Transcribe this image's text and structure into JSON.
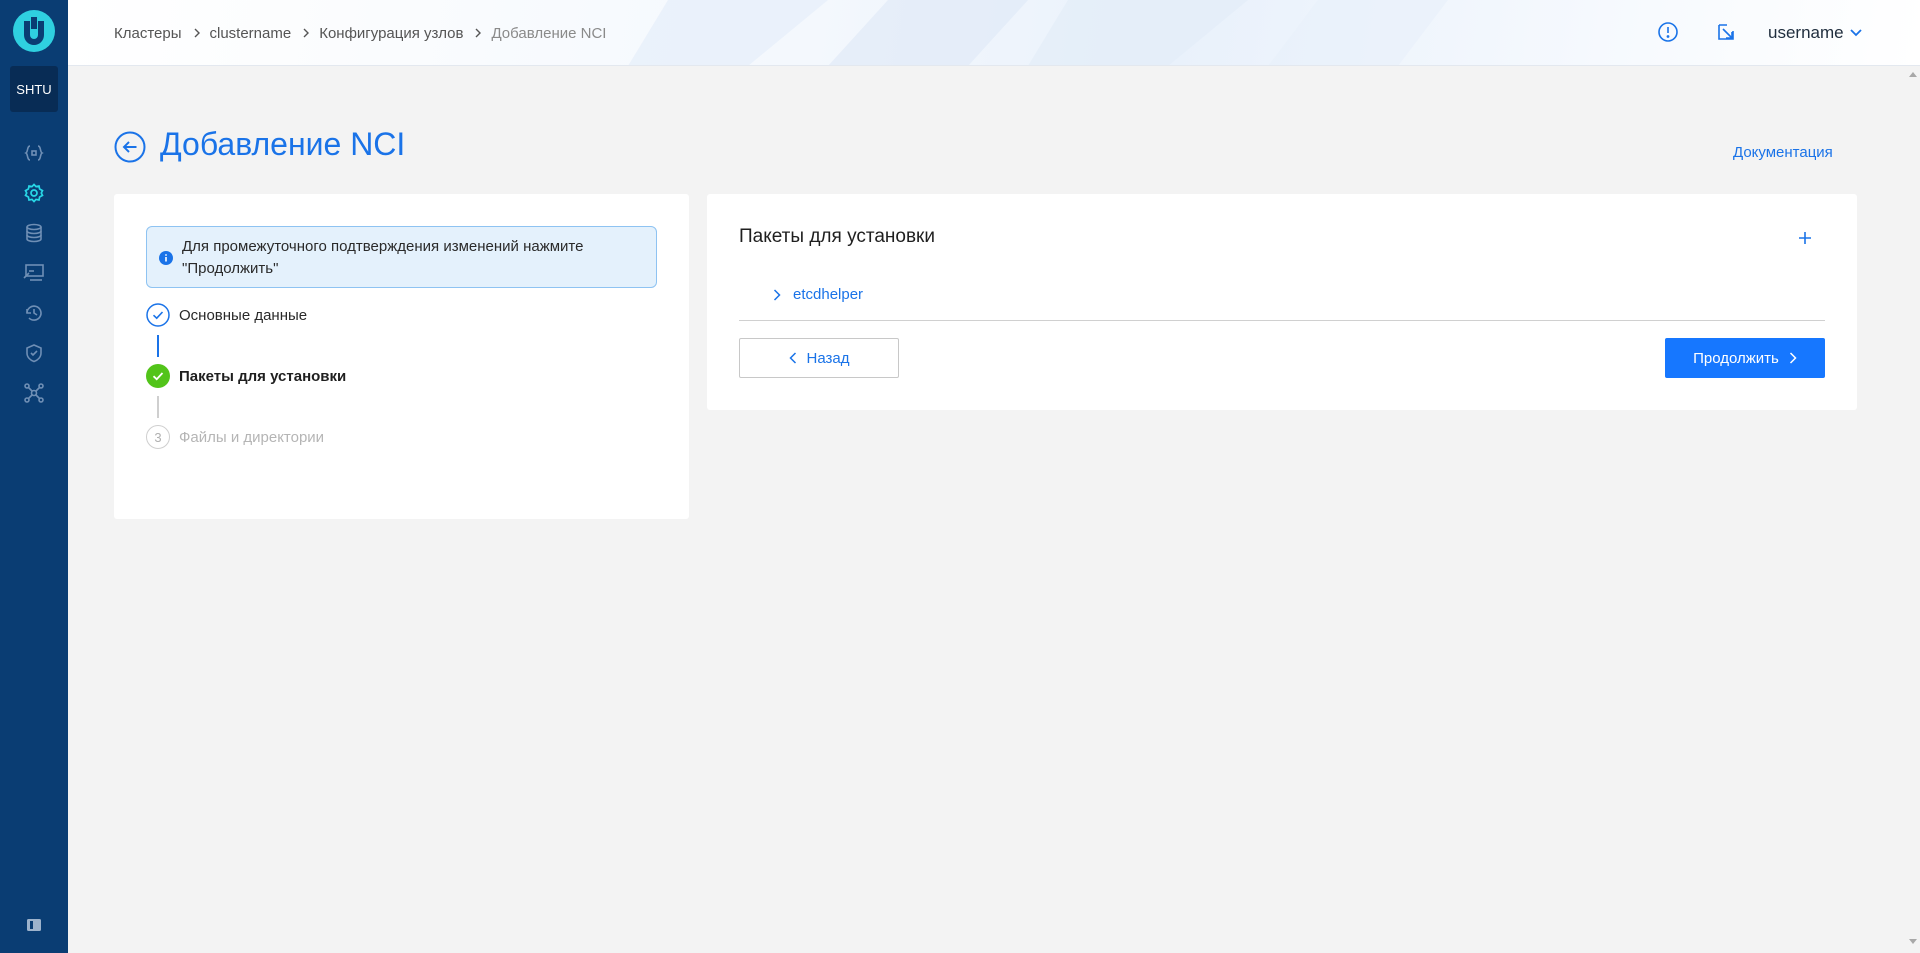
{
  "sidebar": {
    "project_label": "SHTU",
    "items": [
      {
        "icon": "braces-icon"
      },
      {
        "icon": "gear-icon",
        "active": true
      },
      {
        "icon": "database-icon"
      },
      {
        "icon": "monitor-icon"
      },
      {
        "icon": "history-icon"
      },
      {
        "icon": "shield-icon"
      },
      {
        "icon": "network-icon"
      }
    ]
  },
  "header": {
    "breadcrumbs": [
      "Кластеры",
      "clustername",
      "Конфигурация узлов",
      "Добавление NCI"
    ],
    "username": "username"
  },
  "page": {
    "title": "Добавление NCI",
    "doc_link": "Документация"
  },
  "wizard": {
    "info": "Для промежуточного подтверждения изменений нажмите \"Продолжить\"",
    "steps": [
      {
        "label": "Основные данные",
        "state": "done"
      },
      {
        "label": "Пакеты для установки",
        "state": "current"
      },
      {
        "number": "3",
        "label": "Файлы и директории",
        "state": "pending"
      }
    ]
  },
  "packages": {
    "title": "Пакеты для установки",
    "items": [
      "etcdhelper"
    ],
    "back_label": "Назад",
    "next_label": "Продолжить"
  },
  "colors": {
    "sidebar": "#0a3d73",
    "accent": "#1a73e8",
    "primary_button": "#1677ff",
    "success": "#52c41a",
    "active_icon": "#28d7e6"
  }
}
